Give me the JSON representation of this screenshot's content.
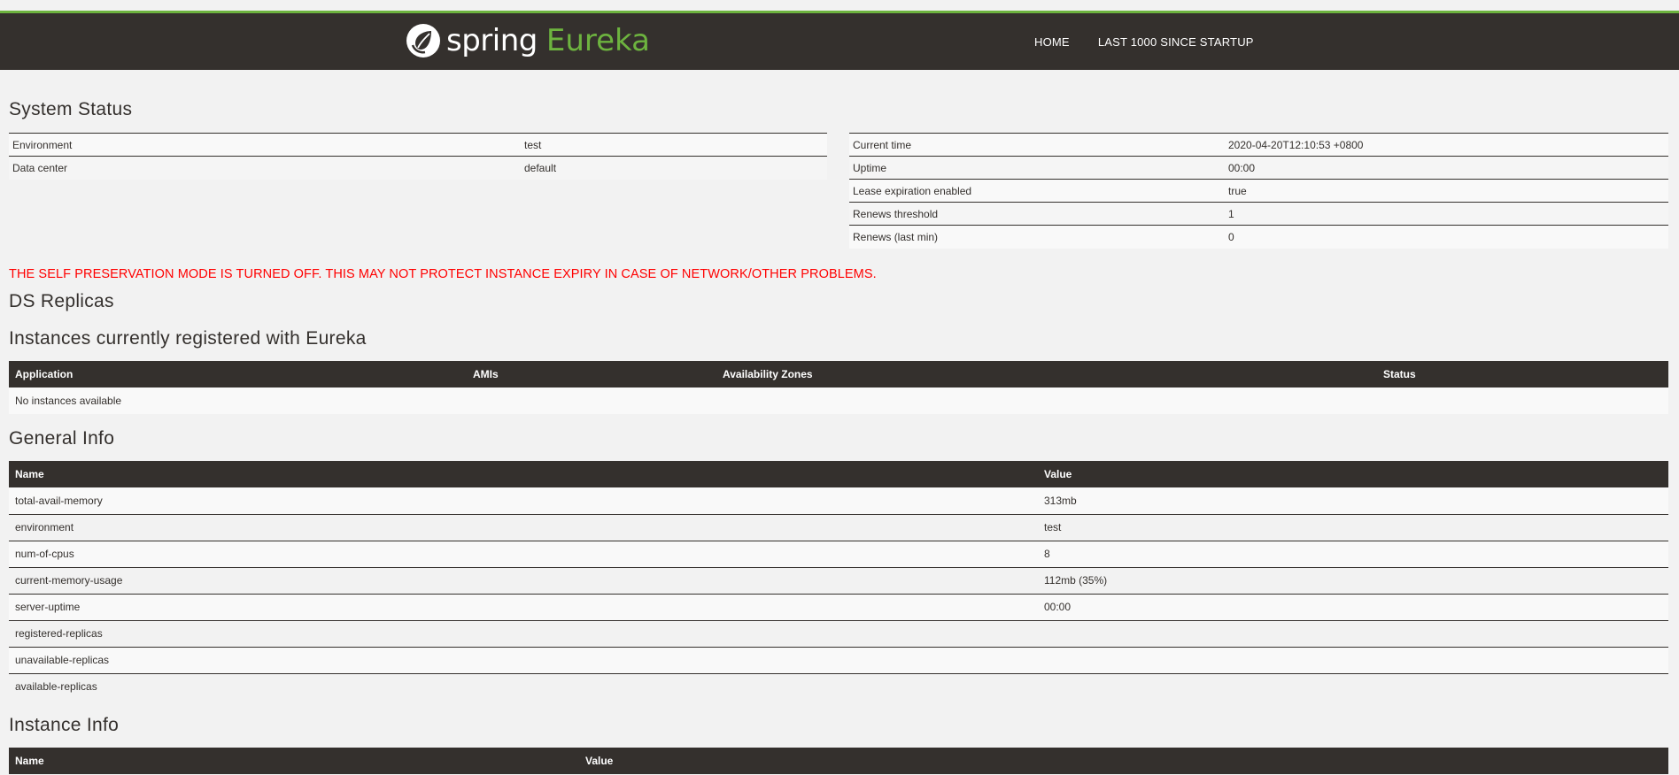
{
  "header": {
    "brand_spring": "spring",
    "brand_eureka": "Eureka",
    "nav": [
      "HOME",
      "LAST 1000 SINCE STARTUP"
    ],
    "colors": {
      "bar": "#34302d",
      "accent": "#6db33f"
    }
  },
  "system_status": {
    "title": "System Status",
    "left": [
      {
        "label": "Environment",
        "value": "test"
      },
      {
        "label": "Data center",
        "value": "default"
      }
    ],
    "right": [
      {
        "label": "Current time",
        "value": "2020-04-20T12:10:53 +0800"
      },
      {
        "label": "Uptime",
        "value": "00:00"
      },
      {
        "label": "Lease expiration enabled",
        "value": "true"
      },
      {
        "label": "Renews threshold",
        "value": "1"
      },
      {
        "label": "Renews (last min)",
        "value": "0"
      }
    ]
  },
  "warning": "THE SELF PRESERVATION MODE IS TURNED OFF. THIS MAY NOT PROTECT INSTANCE EXPIRY IN CASE OF NETWORK/OTHER PROBLEMS.",
  "ds_replicas": {
    "title": "DS Replicas"
  },
  "instances": {
    "title": "Instances currently registered with Eureka",
    "columns": [
      "Application",
      "AMIs",
      "Availability Zones",
      "Status"
    ],
    "empty_text": "No instances available"
  },
  "general_info": {
    "title": "General Info",
    "columns": [
      "Name",
      "Value"
    ],
    "rows": [
      {
        "name": "total-avail-memory",
        "value": "313mb"
      },
      {
        "name": "environment",
        "value": "test"
      },
      {
        "name": "num-of-cpus",
        "value": "8"
      },
      {
        "name": "current-memory-usage",
        "value": "112mb (35%)"
      },
      {
        "name": "server-uptime",
        "value": "00:00"
      },
      {
        "name": "registered-replicas",
        "value": ""
      },
      {
        "name": "unavailable-replicas",
        "value": ""
      },
      {
        "name": "available-replicas",
        "value": ""
      }
    ]
  },
  "instance_info": {
    "title": "Instance Info",
    "columns": [
      "Name",
      "Value"
    ]
  }
}
